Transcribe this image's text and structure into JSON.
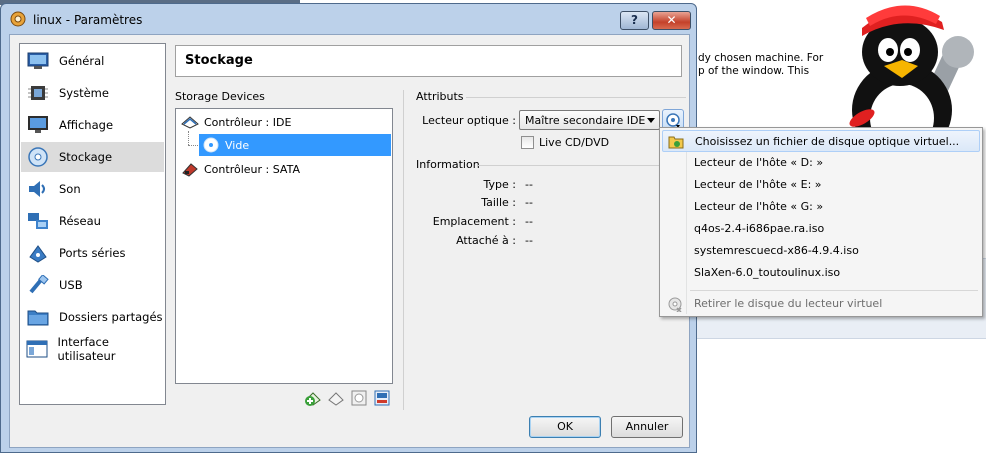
{
  "window": {
    "title": "linux - Paramètres",
    "help_label": "?",
    "close_label": "✕"
  },
  "background": {
    "text_line_1": "dy chosen machine. For",
    "text_line_2": "p of the window. This"
  },
  "categories": [
    {
      "label": "Général",
      "icon": "general-icon"
    },
    {
      "label": "Système",
      "icon": "system-chip-icon"
    },
    {
      "label": "Affichage",
      "icon": "display-monitor-icon"
    },
    {
      "label": "Stockage",
      "icon": "storage-disc-icon",
      "selected": true
    },
    {
      "label": "Son",
      "icon": "speaker-icon"
    },
    {
      "label": "Réseau",
      "icon": "network-icon"
    },
    {
      "label": "Ports séries",
      "icon": "serial-port-icon"
    },
    {
      "label": "USB",
      "icon": "usb-icon"
    },
    {
      "label": "Dossiers partagés",
      "icon": "shared-folder-icon"
    },
    {
      "label": "Interface utilisateur",
      "icon": "user-interface-icon"
    }
  ],
  "page": {
    "title": "Stockage"
  },
  "storage": {
    "section_label": "Storage Devices",
    "tree": [
      {
        "label": "Contrôleur : IDE",
        "icon": "ide-controller-icon",
        "level": 0
      },
      {
        "label": "Vide",
        "icon": "empty-disc-icon",
        "level": 1,
        "selected": true
      },
      {
        "label": "Contrôleur : SATA",
        "icon": "sata-controller-icon",
        "level": 0
      }
    ],
    "toolbar_icons": [
      "add-controller-icon",
      "remove-controller-icon",
      "add-attachment-icon",
      "remove-attachment-icon"
    ]
  },
  "attributes": {
    "section_label": "Attributs",
    "optical_drive_label": "Lecteur optique :",
    "optical_drive_value": "Maître secondaire IDE",
    "live_cd_label": "Live CD/DVD",
    "live_cd_checked": false
  },
  "information": {
    "section_label": "Information",
    "rows": [
      {
        "label": "Type :",
        "value": "--"
      },
      {
        "label": "Taille :",
        "value": "--"
      },
      {
        "label": "Emplacement :",
        "value": "--"
      },
      {
        "label": "Attaché à :",
        "value": "--"
      }
    ]
  },
  "buttons": {
    "ok": "OK",
    "cancel": "Annuler"
  },
  "menu": {
    "items": [
      {
        "label": "Choisissez un fichier de disque optique virtuel...",
        "icon": "folder-open-icon",
        "highlighted": true
      },
      {
        "label": "Lecteur de l'hôte « D: »"
      },
      {
        "label": "Lecteur de l'hôte « E: »"
      },
      {
        "label": "Lecteur de l'hôte « G: »"
      },
      {
        "label": "q4os-2.4-i686pae.ra.iso"
      },
      {
        "label": "systemrescuecd-x86-4.9.4.iso"
      },
      {
        "label": "SlaXen-6.0_toutoulinux.iso"
      }
    ],
    "remove_item": {
      "label": "Retirer le disque du lecteur virtuel",
      "icon": "remove-disc-icon",
      "disabled": true
    }
  },
  "colors": {
    "selection": "#3399ff",
    "title_bar": "#bcd1ea",
    "close_button": "#c4412a"
  }
}
